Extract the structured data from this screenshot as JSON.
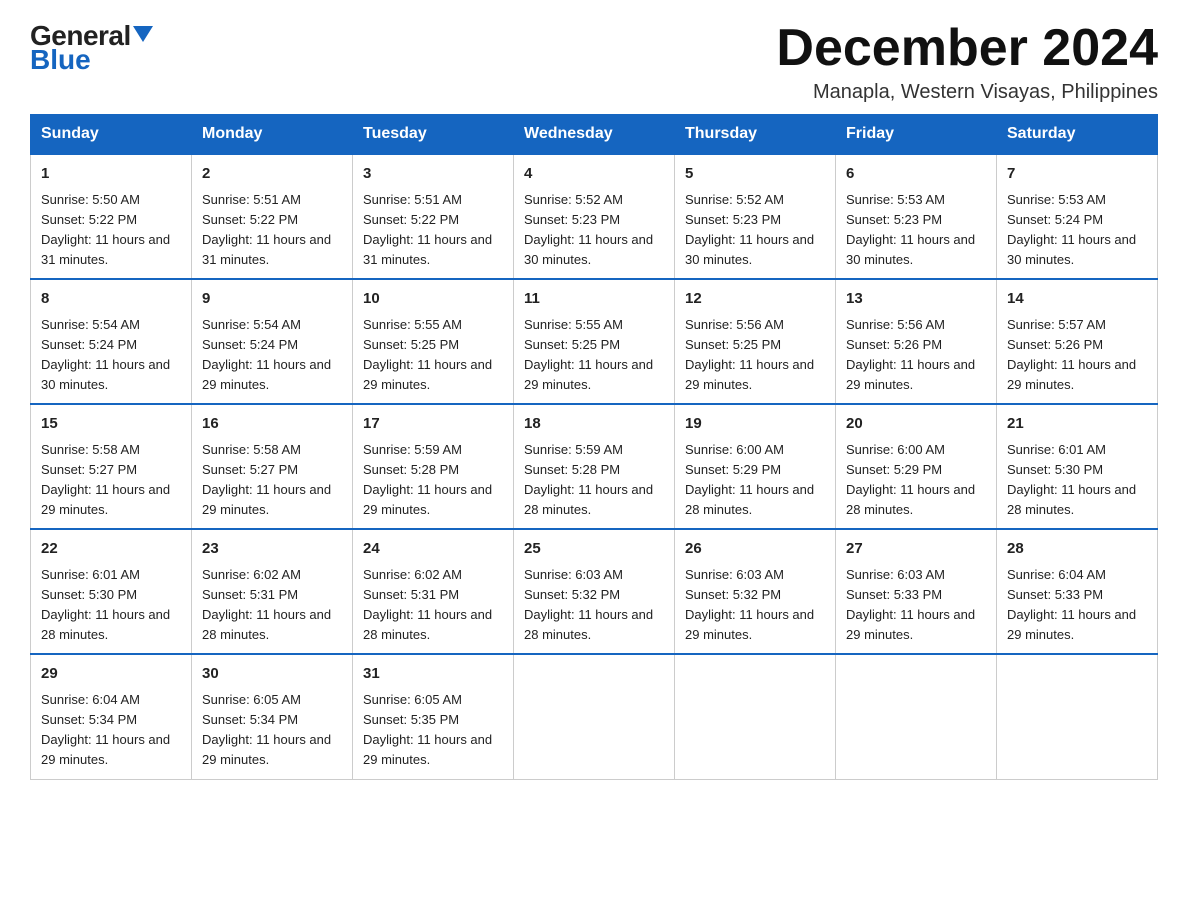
{
  "header": {
    "logo_general": "General",
    "logo_blue": "Blue",
    "month_year": "December 2024",
    "location": "Manapla, Western Visayas, Philippines"
  },
  "days_of_week": [
    "Sunday",
    "Monday",
    "Tuesday",
    "Wednesday",
    "Thursday",
    "Friday",
    "Saturday"
  ],
  "weeks": [
    [
      {
        "day": "1",
        "sunrise": "5:50 AM",
        "sunset": "5:22 PM",
        "daylight": "11 hours and 31 minutes."
      },
      {
        "day": "2",
        "sunrise": "5:51 AM",
        "sunset": "5:22 PM",
        "daylight": "11 hours and 31 minutes."
      },
      {
        "day": "3",
        "sunrise": "5:51 AM",
        "sunset": "5:22 PM",
        "daylight": "11 hours and 31 minutes."
      },
      {
        "day": "4",
        "sunrise": "5:52 AM",
        "sunset": "5:23 PM",
        "daylight": "11 hours and 30 minutes."
      },
      {
        "day": "5",
        "sunrise": "5:52 AM",
        "sunset": "5:23 PM",
        "daylight": "11 hours and 30 minutes."
      },
      {
        "day": "6",
        "sunrise": "5:53 AM",
        "sunset": "5:23 PM",
        "daylight": "11 hours and 30 minutes."
      },
      {
        "day": "7",
        "sunrise": "5:53 AM",
        "sunset": "5:24 PM",
        "daylight": "11 hours and 30 minutes."
      }
    ],
    [
      {
        "day": "8",
        "sunrise": "5:54 AM",
        "sunset": "5:24 PM",
        "daylight": "11 hours and 30 minutes."
      },
      {
        "day": "9",
        "sunrise": "5:54 AM",
        "sunset": "5:24 PM",
        "daylight": "11 hours and 29 minutes."
      },
      {
        "day": "10",
        "sunrise": "5:55 AM",
        "sunset": "5:25 PM",
        "daylight": "11 hours and 29 minutes."
      },
      {
        "day": "11",
        "sunrise": "5:55 AM",
        "sunset": "5:25 PM",
        "daylight": "11 hours and 29 minutes."
      },
      {
        "day": "12",
        "sunrise": "5:56 AM",
        "sunset": "5:25 PM",
        "daylight": "11 hours and 29 minutes."
      },
      {
        "day": "13",
        "sunrise": "5:56 AM",
        "sunset": "5:26 PM",
        "daylight": "11 hours and 29 minutes."
      },
      {
        "day": "14",
        "sunrise": "5:57 AM",
        "sunset": "5:26 PM",
        "daylight": "11 hours and 29 minutes."
      }
    ],
    [
      {
        "day": "15",
        "sunrise": "5:58 AM",
        "sunset": "5:27 PM",
        "daylight": "11 hours and 29 minutes."
      },
      {
        "day": "16",
        "sunrise": "5:58 AM",
        "sunset": "5:27 PM",
        "daylight": "11 hours and 29 minutes."
      },
      {
        "day": "17",
        "sunrise": "5:59 AM",
        "sunset": "5:28 PM",
        "daylight": "11 hours and 29 minutes."
      },
      {
        "day": "18",
        "sunrise": "5:59 AM",
        "sunset": "5:28 PM",
        "daylight": "11 hours and 28 minutes."
      },
      {
        "day": "19",
        "sunrise": "6:00 AM",
        "sunset": "5:29 PM",
        "daylight": "11 hours and 28 minutes."
      },
      {
        "day": "20",
        "sunrise": "6:00 AM",
        "sunset": "5:29 PM",
        "daylight": "11 hours and 28 minutes."
      },
      {
        "day": "21",
        "sunrise": "6:01 AM",
        "sunset": "5:30 PM",
        "daylight": "11 hours and 28 minutes."
      }
    ],
    [
      {
        "day": "22",
        "sunrise": "6:01 AM",
        "sunset": "5:30 PM",
        "daylight": "11 hours and 28 minutes."
      },
      {
        "day": "23",
        "sunrise": "6:02 AM",
        "sunset": "5:31 PM",
        "daylight": "11 hours and 28 minutes."
      },
      {
        "day": "24",
        "sunrise": "6:02 AM",
        "sunset": "5:31 PM",
        "daylight": "11 hours and 28 minutes."
      },
      {
        "day": "25",
        "sunrise": "6:03 AM",
        "sunset": "5:32 PM",
        "daylight": "11 hours and 28 minutes."
      },
      {
        "day": "26",
        "sunrise": "6:03 AM",
        "sunset": "5:32 PM",
        "daylight": "11 hours and 29 minutes."
      },
      {
        "day": "27",
        "sunrise": "6:03 AM",
        "sunset": "5:33 PM",
        "daylight": "11 hours and 29 minutes."
      },
      {
        "day": "28",
        "sunrise": "6:04 AM",
        "sunset": "5:33 PM",
        "daylight": "11 hours and 29 minutes."
      }
    ],
    [
      {
        "day": "29",
        "sunrise": "6:04 AM",
        "sunset": "5:34 PM",
        "daylight": "11 hours and 29 minutes."
      },
      {
        "day": "30",
        "sunrise": "6:05 AM",
        "sunset": "5:34 PM",
        "daylight": "11 hours and 29 minutes."
      },
      {
        "day": "31",
        "sunrise": "6:05 AM",
        "sunset": "5:35 PM",
        "daylight": "11 hours and 29 minutes."
      },
      null,
      null,
      null,
      null
    ]
  ]
}
